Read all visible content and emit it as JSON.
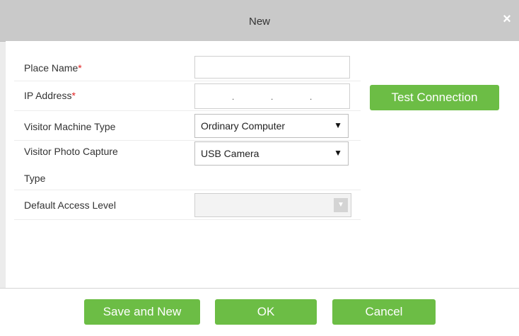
{
  "dialog": {
    "title": "New",
    "close_glyph": "×"
  },
  "form": {
    "place_name": {
      "label": "Place Name",
      "required_mark": "*",
      "value": ""
    },
    "ip_address": {
      "label": "IP Address",
      "required_mark": "*",
      "octet_separator": "."
    },
    "test_connection_label": "Test Connection",
    "visitor_machine_type": {
      "label": "Visitor Machine Type",
      "selected": "Ordinary Computer"
    },
    "visitor_photo_capture_type": {
      "label_line1": "Visitor Photo Capture",
      "label_line2": "Type",
      "selected": "USB Camera"
    },
    "default_access_level": {
      "label": "Default Access Level",
      "selected": ""
    },
    "dropdown_arrow_glyph": "▼"
  },
  "footer": {
    "save_and_new_label": "Save and New",
    "ok_label": "OK",
    "cancel_label": "Cancel"
  },
  "colors": {
    "accent_green": "#6cbd45",
    "required_red": "#e02020",
    "titlebar": "#c9c9c9"
  },
  "icons": {
    "close": "close-icon",
    "dropdown": "chevron-down-icon"
  }
}
